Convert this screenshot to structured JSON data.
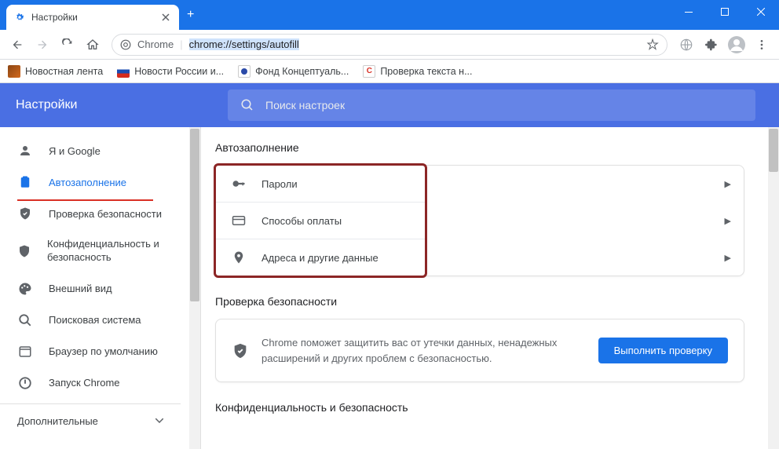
{
  "window": {
    "tab_title": "Настройки",
    "omnibox_prefix": "Chrome",
    "omnibox_url": "chrome://settings/autofill"
  },
  "bookmarks": [
    {
      "label": "Новостная лента",
      "color": "#5f3a1a"
    },
    {
      "label": "Новости России и...",
      "color": "#d52b1e"
    },
    {
      "label": "Фонд Концептуаль...",
      "color": "#2b4aa8"
    },
    {
      "label": "Проверка текста н...",
      "color": "#d93025"
    }
  ],
  "header": {
    "title": "Настройки",
    "search_placeholder": "Поиск настроек"
  },
  "sidebar": {
    "items": [
      {
        "label": "Я и Google",
        "icon": "person"
      },
      {
        "label": "Автозаполнение",
        "icon": "clipboard",
        "active": true
      },
      {
        "label": "Проверка безопасности",
        "icon": "shield-check"
      },
      {
        "label": "Конфиденциальность и безопасность",
        "icon": "shield"
      },
      {
        "label": "Внешний вид",
        "icon": "palette"
      },
      {
        "label": "Поисковая система",
        "icon": "search"
      },
      {
        "label": "Браузер по умолчанию",
        "icon": "browser"
      },
      {
        "label": "Запуск Chrome",
        "icon": "power"
      }
    ],
    "extra": "Дополнительные"
  },
  "main": {
    "section_autofill": "Автозаполнение",
    "autofill_items": [
      {
        "label": "Пароли",
        "icon": "key"
      },
      {
        "label": "Способы оплаты",
        "icon": "card"
      },
      {
        "label": "Адреса и другие данные",
        "icon": "pin"
      }
    ],
    "section_safety": "Проверка безопасности",
    "safety_text": "Chrome поможет защитить вас от утечки данных, ненадежных расширений и других проблем с безопасностью.",
    "safety_button": "Выполнить проверку",
    "section_privacy": "Конфиденциальность и безопасность"
  }
}
